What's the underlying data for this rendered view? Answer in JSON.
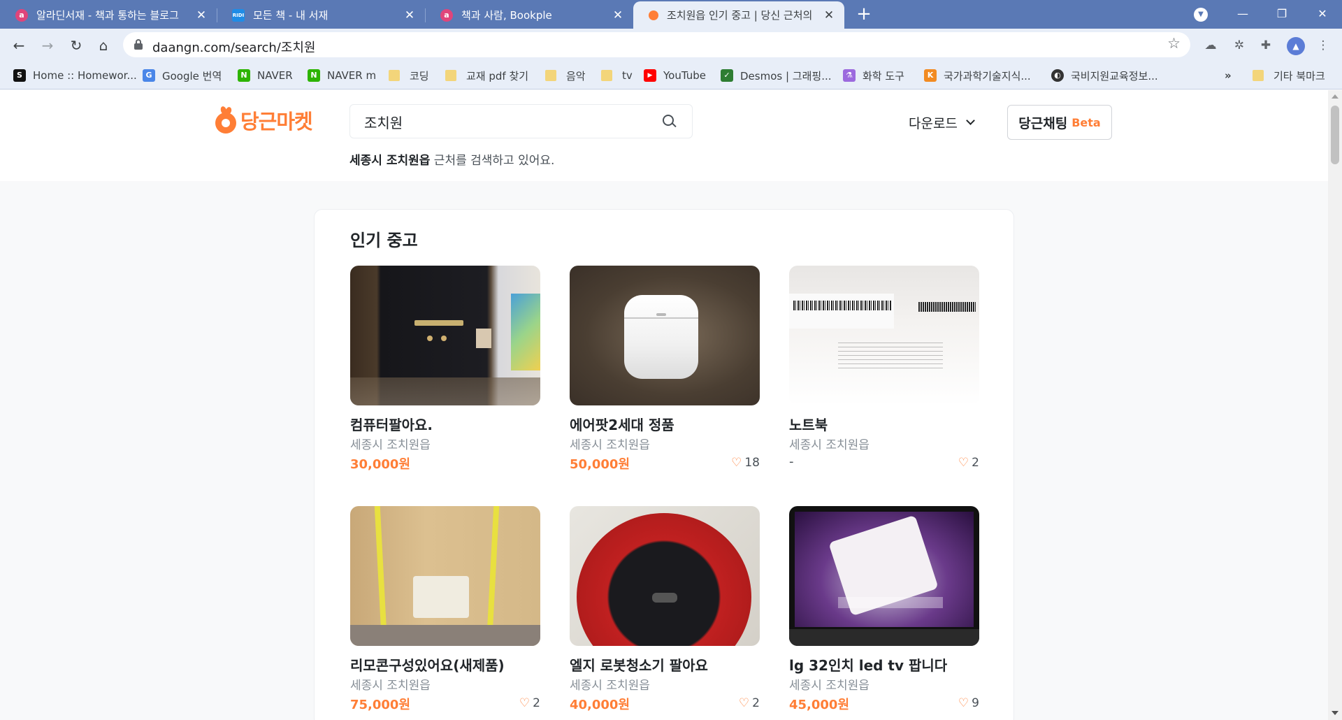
{
  "browser": {
    "tabs": [
      {
        "title": "알라딘서재 - 책과 통하는 블로그",
        "favicon": "aladin-favicon",
        "color": "#e0457b",
        "active": false
      },
      {
        "title": "모든 책 - 내 서재",
        "favicon": "ridi-favicon",
        "color": "#1f8ce6",
        "active": false
      },
      {
        "title": "책과 사람, Bookple",
        "favicon": "aladin-favicon",
        "color": "#e0457b",
        "active": false
      },
      {
        "title": "조치원읍 인기 중고 | 당신 근처의",
        "favicon": "daangn-favicon",
        "color": "#ff7e36",
        "active": true
      }
    ],
    "tab_icons": {
      "ridi": "RIDI",
      "aladin": "a"
    },
    "url": "daangn.com/search/조치원",
    "bookmarks": [
      {
        "label": "Home :: Homewor...",
        "icon": "S",
        "color": "#111111",
        "type": "site"
      },
      {
        "label": "Google 번역",
        "icon": "G",
        "color": "#4a86e8",
        "type": "site"
      },
      {
        "label": "NAVER",
        "icon": "N",
        "color": "#2db400",
        "type": "site"
      },
      {
        "label": "NAVER m",
        "icon": "N",
        "color": "#2db400",
        "type": "site"
      },
      {
        "label": "코딩",
        "type": "folder"
      },
      {
        "label": "교재 pdf 찾기",
        "type": "folder"
      },
      {
        "label": "음악",
        "type": "folder"
      },
      {
        "label": "tv",
        "type": "folder"
      },
      {
        "label": "YouTube",
        "icon": "▶",
        "color": "#ff0000",
        "type": "site"
      },
      {
        "label": "Desmos | 그래핑...",
        "icon": "✓",
        "color": "#2e7d32",
        "type": "site"
      },
      {
        "label": "화학 도구",
        "icon": "⚗",
        "color": "#9c6ade",
        "type": "site"
      },
      {
        "label": "국가과학기술지식...",
        "icon": "K",
        "color": "#f28b22",
        "type": "site"
      },
      {
        "label": "국비지원교육정보...",
        "icon": "◐",
        "color": "#333333",
        "type": "site"
      }
    ],
    "more_bookmarks": "»",
    "other_bookmarks": "기타 북마크"
  },
  "site": {
    "logo_text": "당근마켓",
    "search": {
      "value": "조치원"
    },
    "download_label": "다운로드",
    "chat_label": "당근채팅",
    "chat_badge": "Beta",
    "location_bold": "세종시 조치원읍",
    "location_rest": " 근처를 검색하고 있어요."
  },
  "section": {
    "title": "인기 중고",
    "items": [
      {
        "title": "컴퓨터팔아요.",
        "region": "세종시 조치원읍",
        "price": "30,000원",
        "likes": "",
        "thumb": "t-pc"
      },
      {
        "title": "에어팟2세대 정품",
        "region": "세종시 조치원읍",
        "price": "50,000원",
        "likes": "18",
        "thumb": "t-pods"
      },
      {
        "title": "노트북",
        "region": "세종시 조치원읍",
        "price": "-",
        "likes": "2",
        "thumb": "t-laptop"
      },
      {
        "title": "리모콘구성있어요(새제품)",
        "region": "세종시 조치원읍",
        "price": "75,000원",
        "likes": "2",
        "thumb": "t-box"
      },
      {
        "title": "엘지 로봇청소기 팔아요",
        "region": "세종시 조치원읍",
        "price": "40,000원",
        "likes": "2",
        "thumb": "t-robot"
      },
      {
        "title": "lg 32인치 led tv 팝니다",
        "region": "세종시 조치원읍",
        "price": "45,000원",
        "likes": "9",
        "thumb": "t-tv"
      }
    ]
  },
  "colors": {
    "brand": "#ff7e36",
    "tabbar": "#5a79b5"
  }
}
